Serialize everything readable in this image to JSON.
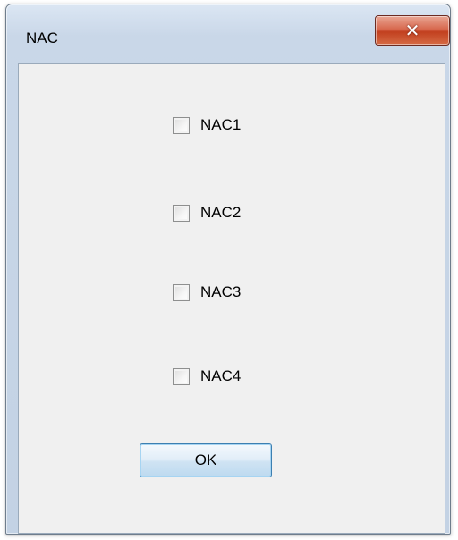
{
  "window": {
    "title": "NAC",
    "close_icon": "close-icon",
    "close_glyph": "✕"
  },
  "checkboxes": [
    {
      "label": "NAC1",
      "checked": false
    },
    {
      "label": "NAC2",
      "checked": false
    },
    {
      "label": "NAC3",
      "checked": false
    },
    {
      "label": "NAC4",
      "checked": false
    }
  ],
  "buttons": {
    "ok_label": "OK"
  },
  "colors": {
    "close_button": "#c2401f",
    "ok_button_border": "#3c7fb1",
    "client_background": "#f0f0f0"
  }
}
